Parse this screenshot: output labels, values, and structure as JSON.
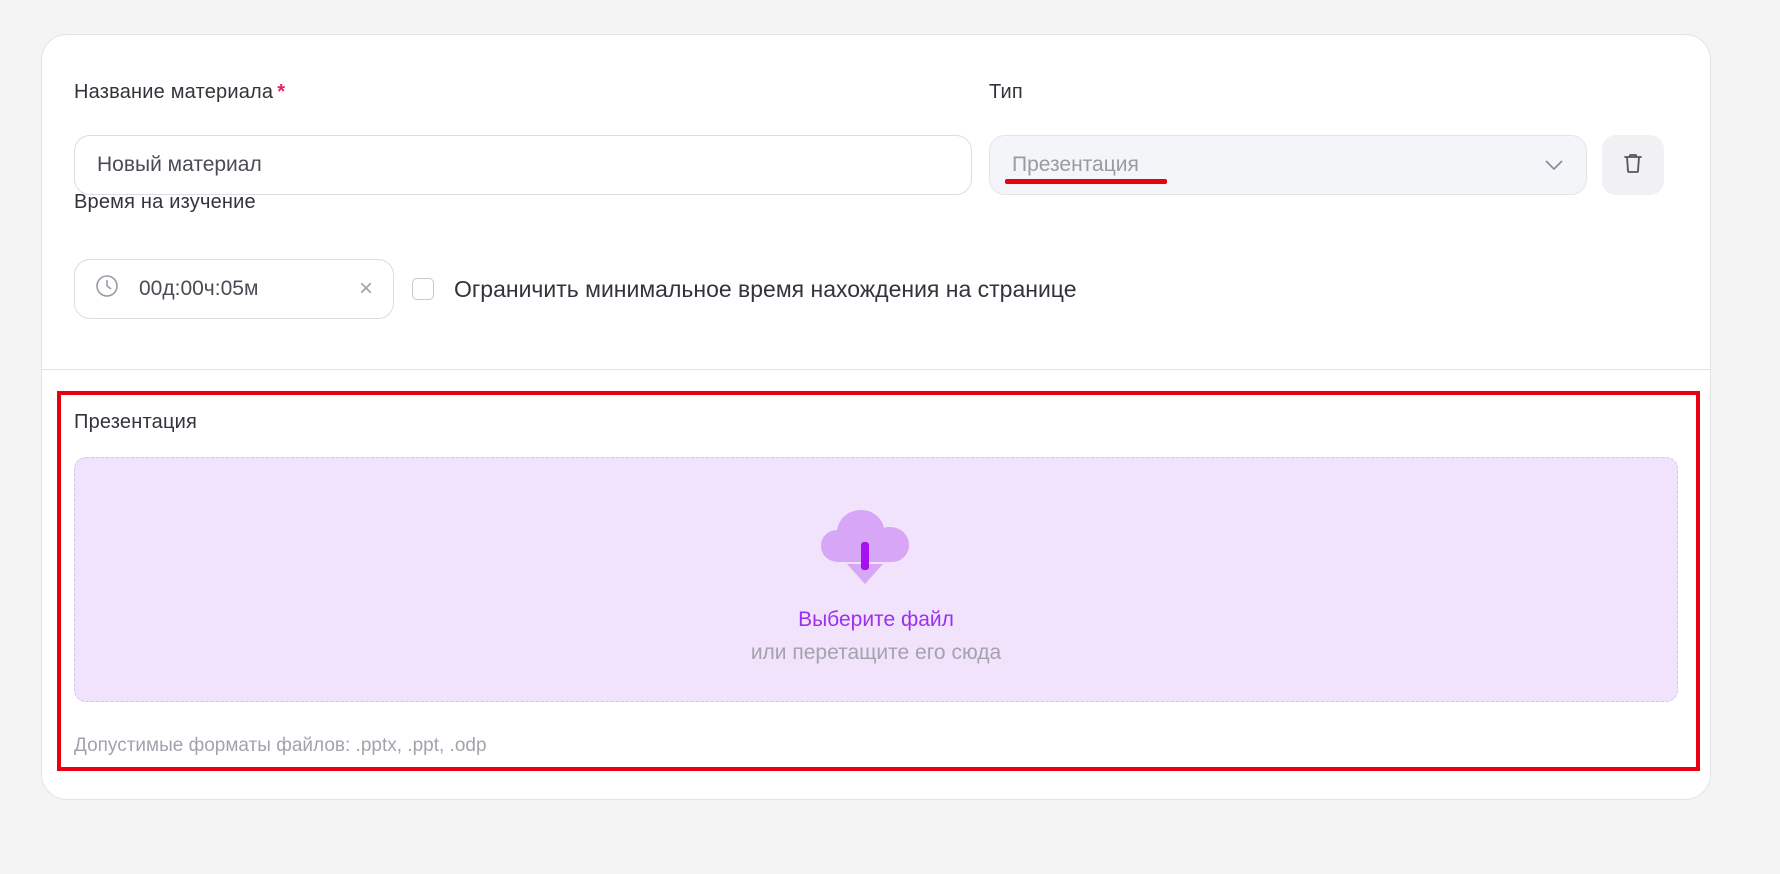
{
  "form": {
    "name_label": "Название материала",
    "required_mark": "*",
    "name_value": "Новый материал",
    "type_label": "Тип",
    "type_value": "Презентация",
    "time_label": "Время на изучение",
    "time_value": "00д:00ч:05м",
    "time_clear": "×",
    "limit_checkbox_label": "Ограничить минимальное время нахождения на странице",
    "limit_checked": false
  },
  "upload": {
    "section_title": "Презентация",
    "choose_file": "Выберите файл",
    "drag_hint": "или перетащите его сюда",
    "formats_hint": "Допустимые форматы файлов: .pptx, .ppt, .odp"
  },
  "icons": {
    "select": "chevron-down-icon",
    "delete": "trash-icon",
    "time": "clock-icon",
    "clear": "close-icon",
    "upload": "cloud-download-icon"
  },
  "colors": {
    "accent": "#9b30f0",
    "required": "#e0245e",
    "dropzone_bg": "#f2e3fd",
    "highlight": "#e8000e"
  }
}
